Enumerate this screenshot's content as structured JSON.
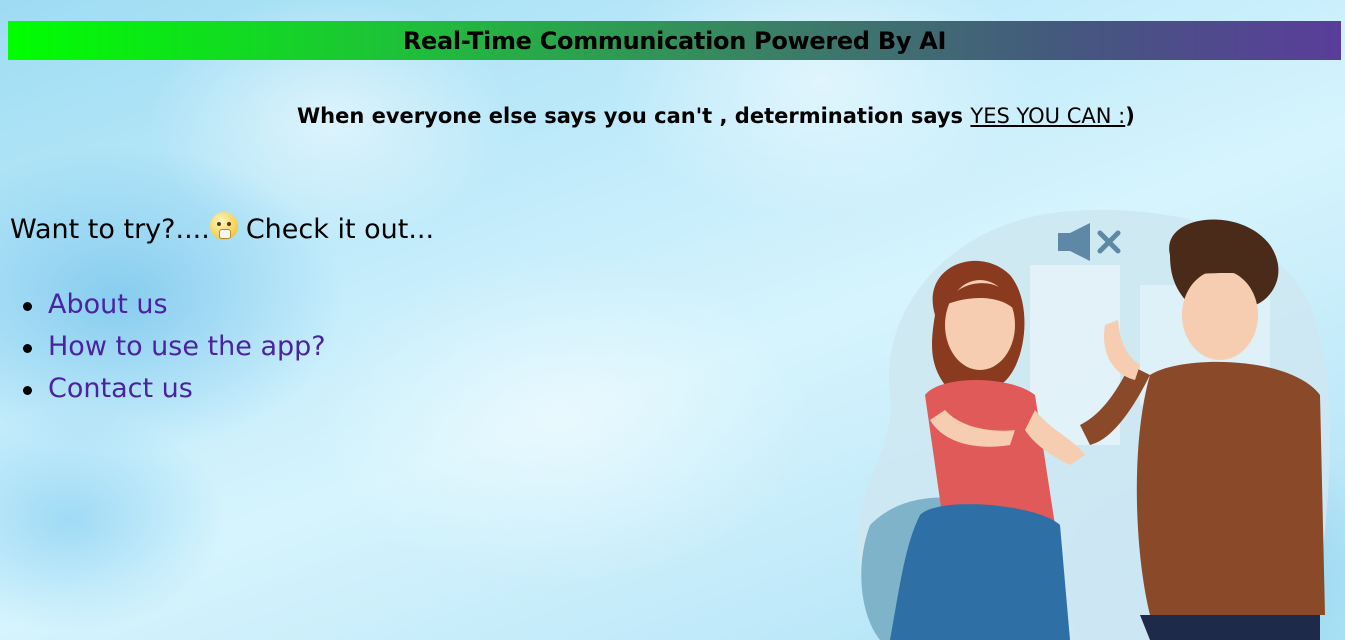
{
  "banner": {
    "title": "Real-Time Communication Powered By AI"
  },
  "tagline": {
    "text": "When everyone else says you can't , determination says ",
    "highlight": "YES YOU CAN :",
    "suffix": ")"
  },
  "cta": {
    "prefix": "Want to try?....",
    "emoji": "thinking-face-icon",
    "suffix": "Check it out..."
  },
  "nav": {
    "items": [
      {
        "label": "About us"
      },
      {
        "label": "How to use the app?"
      },
      {
        "label": "Contact us"
      }
    ]
  },
  "colors": {
    "banner_gradient_start": "#00ff00",
    "banner_gradient_end": "#5a3d9a",
    "link": "#4b22a0",
    "background": "#c3ecfb"
  },
  "illustration": {
    "icon": "sign-language-illustration",
    "muted_icon": "speaker-muted-icon"
  }
}
